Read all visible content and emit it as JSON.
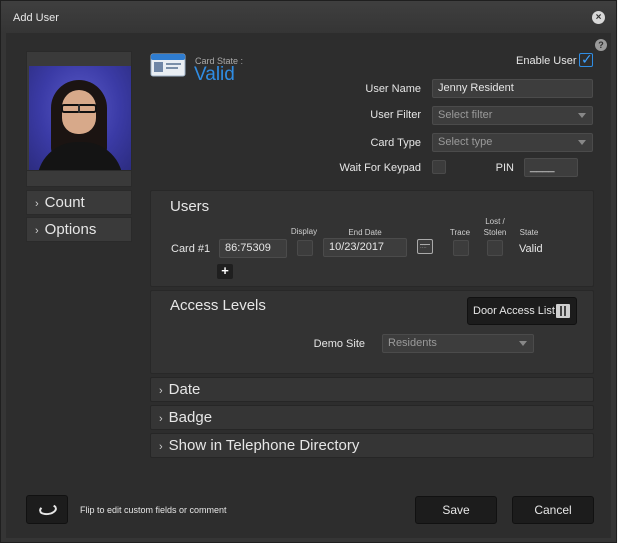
{
  "window": {
    "title": "Add User",
    "close_glyph": "×"
  },
  "sidebar": {
    "items": [
      {
        "label": "Count",
        "icon": "chevron-right-icon"
      },
      {
        "label": "Options",
        "icon": "chevron-right-icon"
      }
    ]
  },
  "card_state": {
    "label": "Card State :",
    "value": "Valid",
    "value_color": "#2f8de4"
  },
  "header": {
    "help_glyph": "?",
    "enable_user_label": "Enable User",
    "enable_user_checked": true
  },
  "form": {
    "user_name_label": "User Name",
    "user_name_value": "Jenny Resident",
    "user_filter_label": "User Filter",
    "user_filter_placeholder": "Select filter",
    "card_type_label": "Card Type",
    "card_type_placeholder": "Select type",
    "wait_keypad_label": "Wait For Keypad",
    "wait_keypad_checked": false,
    "pin_label": "PIN",
    "pin_value": "____"
  },
  "users_panel": {
    "title": "Users",
    "col_display": "Display",
    "col_end_date": "End Date",
    "col_trace": "Trace",
    "col_lost_stolen": "Lost /\nStolen",
    "col_state": "State",
    "card_label": "Card #1",
    "card_number": "86:75309",
    "end_date": "10/23/2017",
    "state": "Valid",
    "add_glyph": "+"
  },
  "access_panel": {
    "title": "Access Levels",
    "door_button_label": "Door Access List",
    "site_label": "Demo Site",
    "site_value": "Residents"
  },
  "sections": [
    {
      "label": "Date"
    },
    {
      "label": "Badge"
    },
    {
      "label": "Show in Telephone Directory"
    }
  ],
  "footer": {
    "flip_text": "Flip to edit custom fields or comment",
    "save_label": "Save",
    "cancel_label": "Cancel"
  },
  "icons": {
    "chevron": "›",
    "checkmark": "✓"
  }
}
